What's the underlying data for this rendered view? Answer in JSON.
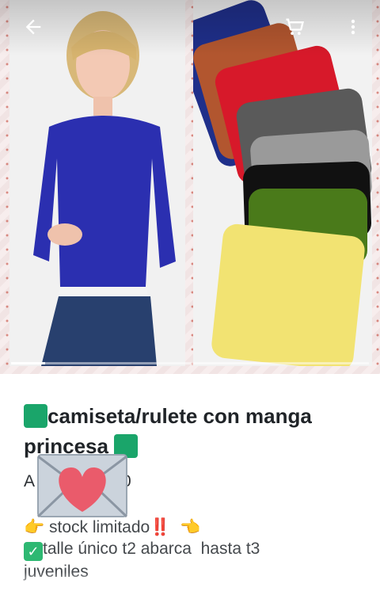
{
  "toolbar": {
    "back_icon": "arrow-left-icon",
    "cart_icon": "shopping-cart-icon",
    "more_icon": "more-vertical-icon"
  },
  "gallery": {
    "image_count_hint": "multiple",
    "active_index": 1,
    "colors": [
      "#1f2f8a",
      "#b2562f",
      "#d7192a",
      "#5a5a5a",
      "#9a9a9a",
      "#111111",
      "#4a7a1a",
      "#f2e372"
    ]
  },
  "product": {
    "title_line1": "camiseta/rulete con manga",
    "title_line2": "princesa",
    "price_prefix": "A",
    "price_suffix": "0",
    "desc_line1_text": "stock limitado",
    "desc_line1_marks": "‼️",
    "desc_line2_text": "talle único t2 abarca  hasta t3",
    "desc_line3_text": "juveniles"
  },
  "colors": {
    "accent_green": "#1aa56a",
    "title_text": "#202428",
    "body_text": "#45494d"
  }
}
